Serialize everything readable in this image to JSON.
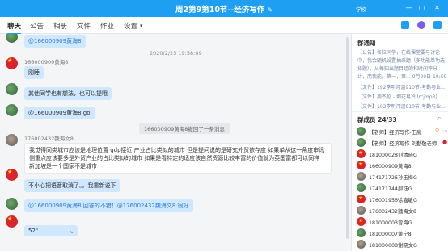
{
  "header": {
    "title": "周2第9第10节--经济写作",
    "edit_icon": "✎",
    "user_label": "学校",
    "min_icon": "—",
    "max_icon": "□",
    "close_icon": "✕"
  },
  "nav": {
    "tabs": [
      "聊天",
      "公告",
      "相册",
      "文件",
      "作业",
      "设置"
    ],
    "dropdown_glyph": "▾"
  },
  "chat": {
    "top_bubble": "@166000909黄海8",
    "timestamp": "2020/2/25 19:58:09",
    "messages": [
      {
        "name": "166000909黄海8",
        "text": "刚睡"
      },
      {
        "name": "",
        "text": "其他同学也有想法，也可以提哦"
      },
      {
        "name": "",
        "text": "@166000909黄海8 go"
      }
    ],
    "system_notice": "166000909黄海8撤回了一条消息",
    "long_message": {
      "name": "176002432魏海文8",
      "text": "我觉得同类城市应该是地理位置 gdp接近 产业占比类似的城市 但是提问说的是研究外贸依存度 如果单从这一角度审讯侧重点应该要多是外贸产业的占比类似的城市 如果是看特定的适应该自然资源比较丰富的价值就为英国富都可以同样 新加坡是一个国家不是城市"
    },
    "reply_short": "不小心把语音取消了。。我重新说下",
    "reply_mention": "@166000909黄海8 回答的不错！@176002432魏海文8 很好",
    "voice_label": "52\""
  },
  "panel": {
    "notice_title": "群通知",
    "notices": [
      "【公告】各位同学，在线课堂要与讨论",
      "中，我会随机设置抽采题（多功能单功选",
      "择题），从每知出题目组的和时间评分",
      "计，而我能，第一，第... 9月20日 10:59",
      "【文件】192李明河温910节-考勤与业...",
      "【文件】周杰伦 - 烟花易冷.lrcjmp3]...",
      "【文件】192李明河温910节-考勤与业..."
    ],
    "members_title": "群成员 24/33",
    "members": [
      "【老师】经济写作-王房",
      "【老师】经济写作-刘勤敬老师",
      "181000028刘清晓G",
      "166000909黄海8",
      "174171726孙玉梅G",
      "174171744郝钰G",
      "176001956徐嘉敏G",
      "176002432魏海文8",
      "181000003曾海G",
      "181000007黄宁8",
      "181000008谢晓文G"
    ],
    "search_icon": "search-icon"
  }
}
